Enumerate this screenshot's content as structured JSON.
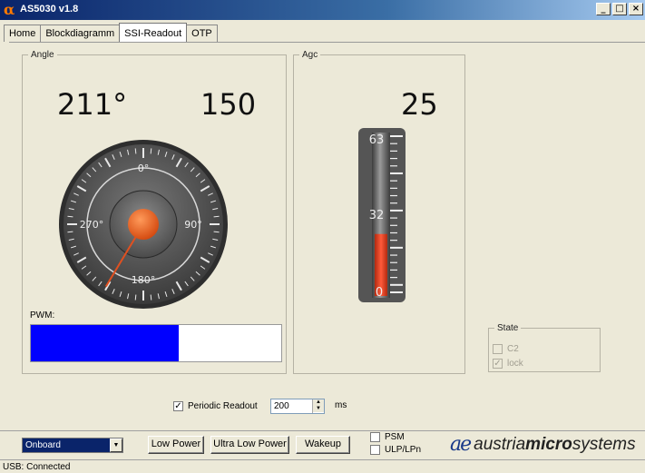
{
  "window": {
    "title": "AS5030 v1.8",
    "logo_glyph": "α",
    "buttons": [
      "_",
      "□",
      "×"
    ]
  },
  "tabs": [
    {
      "label": "Home",
      "active": false
    },
    {
      "label": "Blockdiagramm",
      "active": false
    },
    {
      "label": "SSI-Readout",
      "active": true
    },
    {
      "label": "OTP",
      "active": false
    }
  ],
  "angle_group": {
    "legend": "Angle",
    "angle_value": "211°",
    "raw_value": "150",
    "gauge_labels": {
      "top": "0°",
      "right": "90°",
      "bottom": "180°",
      "left": "270°"
    },
    "needle_angle_deg": 211,
    "pwm_label": "PWM:",
    "pwm_fraction": 0.59
  },
  "agc_group": {
    "legend": "Agc",
    "value": "25",
    "scale_labels": {
      "max": "63",
      "mid": "32",
      "min": "0"
    },
    "level_fraction": 0.397,
    "level_value": 25,
    "scale_max": 63
  },
  "state_group": {
    "legend": "State",
    "items": [
      {
        "label": "C2",
        "checked": false
      },
      {
        "label": "lock",
        "checked": true
      }
    ]
  },
  "periodic": {
    "label": "Periodic Readout",
    "checked": true,
    "interval": "200",
    "unit": "ms"
  },
  "bottom": {
    "interface_select": "Onboard",
    "buttons": {
      "low_power": "Low Power",
      "ultra_low_power": "Ultra Low Power",
      "wakeup": "Wakeup"
    },
    "checks": {
      "psm": "PSM",
      "ulp": "ULP/LPn"
    },
    "brand": {
      "mark": "ae",
      "prefix": "austria",
      "bold": "micro",
      "suffix": "systems"
    }
  },
  "status": "USB: Connected",
  "colors": {
    "pwm_fill": "#0000ff",
    "needle": "#e05020",
    "agc_level": "#e8482a",
    "titlebar": "#0a246a"
  }
}
